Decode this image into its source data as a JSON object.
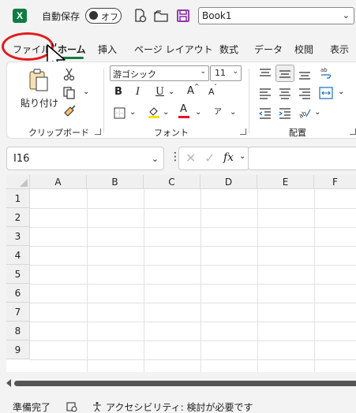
{
  "titlebar": {
    "app_icon_letter": "X",
    "autosave_label": "自動保存",
    "autosave_state": "オフ",
    "filename": "Book1",
    "icons": [
      "excel-logo",
      "file-check-icon",
      "folder-icon",
      "save-icon",
      "chevron-down-icon"
    ]
  },
  "tabs": [
    "ファイル",
    "ホーム",
    "挿入",
    "ページ レイアウト",
    "数式",
    "データ",
    "校閲",
    "表示"
  ],
  "active_tab": "ホーム",
  "ribbon": {
    "clipboard": {
      "paste_label": "貼り付け",
      "group_label": "クリップボード"
    },
    "font": {
      "font_name": "游ゴシック",
      "font_size": "11",
      "bold": "B",
      "italic": "I",
      "underline": "U",
      "grow": "A",
      "shrink": "A",
      "color_letter": "A",
      "phonetic": "ア",
      "group_label": "フォント"
    },
    "alignment": {
      "group_label": "配置"
    }
  },
  "formula_bar": {
    "name_box": "I16",
    "fx": "fx",
    "formula": ""
  },
  "grid": {
    "columns": [
      "A",
      "B",
      "C",
      "D",
      "E",
      "F"
    ],
    "rows": [
      "1",
      "2",
      "3",
      "4",
      "5",
      "6",
      "7",
      "8",
      "9"
    ]
  },
  "statusbar": {
    "ready": "準備完了",
    "accessibility": "アクセシビリティ: 検討が必要です"
  },
  "colors": {
    "excel_green": "#107c41",
    "annotation_red": "#e51a1a",
    "save_purple": "#8a2da5",
    "font_color_red": "#e81123",
    "highlight_yellow": "#f2e01b"
  }
}
